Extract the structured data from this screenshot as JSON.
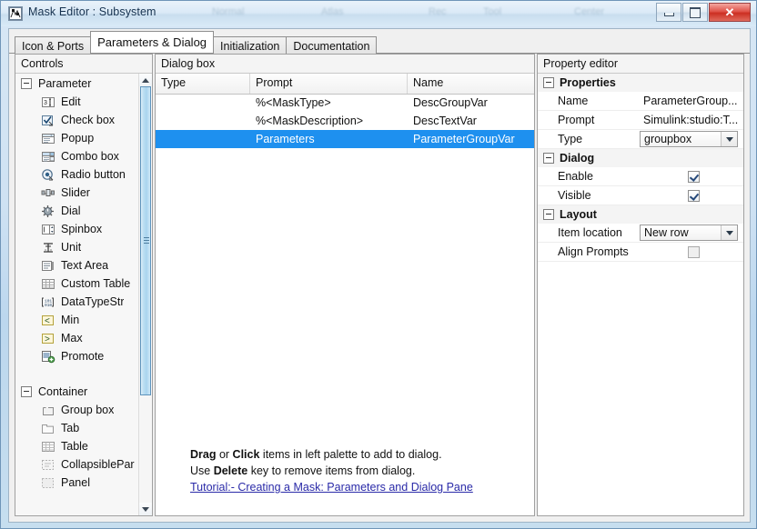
{
  "window": {
    "title": "Mask Editor : Subsystem",
    "icon": "mask-editor-icon",
    "ghost_texts": [
      "Normal",
      "Atlas",
      "Rec",
      "Tool",
      "Center"
    ],
    "buttons": [
      {
        "name": "minimize-button",
        "label": "–"
      },
      {
        "name": "maximize-button",
        "label": "❐"
      },
      {
        "name": "close-button",
        "label": "✕"
      }
    ]
  },
  "tabs": [
    {
      "label": "Icon & Ports",
      "active": false
    },
    {
      "label": "Parameters & Dialog",
      "active": true
    },
    {
      "label": "Initialization",
      "active": false
    },
    {
      "label": "Documentation",
      "active": false
    }
  ],
  "palette": {
    "header": "Controls",
    "groups": [
      {
        "label": "Parameter",
        "expanded": true,
        "items": [
          {
            "label": "Edit",
            "icon": "edit-icon"
          },
          {
            "label": "Check box",
            "icon": "checkbox-icon"
          },
          {
            "label": "Popup",
            "icon": "popup-icon"
          },
          {
            "label": "Combo box",
            "icon": "combobox-icon"
          },
          {
            "label": "Radio button",
            "icon": "radio-button-icon"
          },
          {
            "label": "Slider",
            "icon": "slider-icon"
          },
          {
            "label": "Dial",
            "icon": "dial-icon"
          },
          {
            "label": "Spinbox",
            "icon": "spinbox-icon"
          },
          {
            "label": "Unit",
            "icon": "unit-icon"
          },
          {
            "label": "Text Area",
            "icon": "text-area-icon"
          },
          {
            "label": "Custom Table",
            "icon": "custom-table-icon"
          },
          {
            "label": "DataTypeStr",
            "icon": "datatypestr-icon"
          },
          {
            "label": "Min",
            "icon": "min-icon"
          },
          {
            "label": "Max",
            "icon": "max-icon"
          },
          {
            "label": "Promote",
            "icon": "promote-icon"
          }
        ]
      },
      {
        "label": "Container",
        "expanded": true,
        "items": [
          {
            "label": "Group box",
            "icon": "group-box-icon"
          },
          {
            "label": "Tab",
            "icon": "tab-icon"
          },
          {
            "label": "Table",
            "icon": "table-icon"
          },
          {
            "label": "CollapsiblePar",
            "icon": "collapsible-panel-icon"
          },
          {
            "label": "Panel",
            "icon": "panel-icon"
          }
        ]
      }
    ],
    "scrollbar": {
      "up": "scroll-up-arrow",
      "down": "scroll-down-arrow"
    }
  },
  "dialog_box": {
    "header": "Dialog box",
    "columns": [
      "Type",
      "Prompt",
      "Name"
    ],
    "rows": [
      {
        "type_icon": "group-box-icon",
        "prompt": "%<MaskType>",
        "name": "DescGroupVar",
        "selected": false,
        "depth": 0
      },
      {
        "type_icon": "text-glyph-A",
        "prompt": "%<MaskDescription>",
        "name": "DescTextVar",
        "selected": false,
        "depth": 1
      },
      {
        "type_icon": "folder-icon",
        "prompt": "Parameters",
        "name": "ParameterGroupVar",
        "selected": true,
        "depth": 0
      }
    ],
    "help": {
      "line1_parts": [
        "Drag",
        " or ",
        "Click",
        " items in left palette to add to dialog."
      ],
      "line2_parts": [
        "Use ",
        "Delete",
        " key to remove items from dialog."
      ],
      "link": "Tutorial:- Creating a Mask: Parameters and Dialog Pane"
    }
  },
  "property_editor": {
    "header": "Property editor",
    "sections": [
      {
        "label": "Properties",
        "expanded": true,
        "rows": [
          {
            "name": "Name",
            "value": "ParameterGroup...",
            "kind": "text"
          },
          {
            "name": "Prompt",
            "value": "Simulink:studio:T...",
            "kind": "text"
          },
          {
            "name": "Type",
            "value": "groupbox",
            "kind": "combo"
          }
        ]
      },
      {
        "label": "Dialog",
        "expanded": true,
        "rows": [
          {
            "name": "Enable",
            "value": "",
            "kind": "checkbox",
            "checked": true
          },
          {
            "name": "Visible",
            "value": "",
            "kind": "checkbox",
            "checked": true
          }
        ]
      },
      {
        "label": "Layout",
        "expanded": true,
        "rows": [
          {
            "name": "Item location",
            "value": "New row",
            "kind": "combo"
          },
          {
            "name": "Align Prompts",
            "value": "",
            "kind": "checkbox",
            "checked": false
          }
        ]
      }
    ]
  },
  "colors": {
    "selection_blue": "#1e90ef",
    "link_blue": "#2a2aa8",
    "title_gradient_top": "#e9f2fa",
    "close_red": "#cc2f22"
  }
}
